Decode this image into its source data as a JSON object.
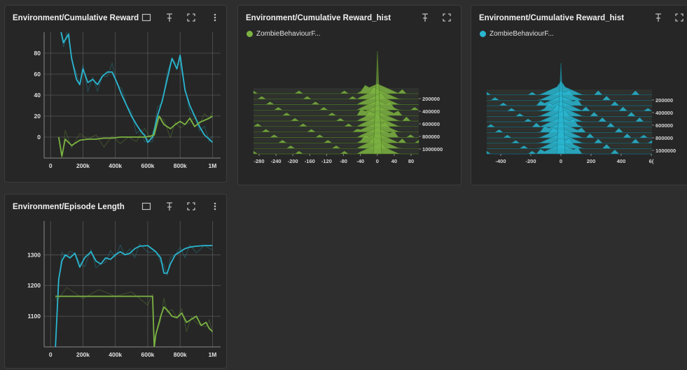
{
  "colors": {
    "cyan": "#29b6d0",
    "green": "#7cb342",
    "cyan_faint": "#2b4b52",
    "green_faint": "#3d4a2e",
    "grid": "#4a4a4a",
    "card": "#262626"
  },
  "cards": {
    "reward": {
      "title": "Environment/Cumulative Reward"
    },
    "hist_green": {
      "title": "Environment/Cumulative Reward_hist",
      "legend": "ZombieBehaviourF..."
    },
    "hist_cyan": {
      "title": "Environment/Cumulative Reward_hist",
      "legend": "ZombieBehaviourF..."
    },
    "length": {
      "title": "Environment/Episode Length"
    }
  },
  "chart_data": [
    {
      "id": "reward",
      "type": "line",
      "title": "Environment/Cumulative Reward",
      "xlim": [
        -40000,
        1050000
      ],
      "ylim": [
        -20,
        100
      ],
      "x_ticks": [
        0,
        200000,
        400000,
        600000,
        800000,
        1000000
      ],
      "x_tick_labels": [
        "0",
        "200k",
        "400k",
        "600k",
        "800k",
        "1M"
      ],
      "y_ticks": [
        0,
        20,
        40,
        60,
        80
      ],
      "y_tick_labels": [
        "0",
        "20",
        "40",
        "60",
        "80"
      ],
      "series": [
        {
          "color": "#29b6d0",
          "x": [
            50000,
            80000,
            110000,
            130000,
            160000,
            180000,
            200000,
            230000,
            260000,
            290000,
            320000,
            350000,
            380000,
            410000,
            440000,
            470000,
            500000,
            530000,
            560000,
            580000,
            600000,
            630000,
            660000,
            690000,
            720000,
            750000,
            780000,
            800000,
            830000,
            860000,
            890000,
            920000,
            950000,
            980000,
            1000000
          ],
          "y": [
            110,
            90,
            98,
            75,
            55,
            50,
            65,
            52,
            55,
            50,
            58,
            62,
            62,
            52,
            40,
            30,
            20,
            12,
            5,
            2,
            -5,
            0,
            20,
            35,
            55,
            75,
            65,
            78,
            45,
            30,
            20,
            10,
            2,
            -2,
            -5
          ]
        },
        {
          "color": "#7cb342",
          "x": [
            50000,
            70000,
            90000,
            130000,
            180000,
            230000,
            280000,
            330000,
            380000,
            430000,
            480000,
            530000,
            580000,
            620000,
            640000,
            670000,
            700000,
            740000,
            770000,
            800000,
            830000,
            860000,
            890000,
            920000,
            950000,
            980000,
            1000000
          ],
          "y": [
            0,
            -18,
            -2,
            -8,
            -3,
            -2,
            -2,
            -1,
            -1,
            0,
            0,
            0,
            0,
            1,
            2,
            20,
            12,
            8,
            12,
            15,
            12,
            18,
            10,
            14,
            16,
            18,
            20
          ]
        }
      ]
    },
    {
      "id": "hist_green",
      "type": "histogram",
      "x_tick_labels": [
        "-280",
        "-240",
        "-200",
        "-160",
        "-120",
        "-80",
        "-40",
        "0",
        "40",
        "80"
      ],
      "y_tick_labels": [
        "200000",
        "400000",
        "600000",
        "800000",
        "1000000"
      ]
    },
    {
      "id": "hist_cyan",
      "type": "histogram",
      "x_tick_labels": [
        "-400",
        "-200",
        "0",
        "200",
        "400",
        "6("
      ],
      "y_tick_labels": [
        "200000",
        "400000",
        "600000",
        "800000",
        "1000000"
      ]
    },
    {
      "id": "length",
      "type": "line",
      "title": "Environment/Episode Length",
      "xlim": [
        -40000,
        1050000
      ],
      "ylim": [
        1000,
        1410
      ],
      "x_ticks": [
        0,
        200000,
        400000,
        600000,
        800000,
        1000000
      ],
      "x_tick_labels": [
        "0",
        "200k",
        "400k",
        "600k",
        "800k",
        "1M"
      ],
      "y_ticks": [
        1100,
        1200,
        1300
      ],
      "y_tick_labels": [
        "1100",
        "1200",
        "1300"
      ],
      "series": [
        {
          "color": "#29b6d0",
          "x": [
            30000,
            50000,
            70000,
            90000,
            120000,
            150000,
            180000,
            210000,
            250000,
            280000,
            310000,
            340000,
            370000,
            400000,
            430000,
            460000,
            490000,
            520000,
            550000,
            600000,
            650000,
            680000,
            700000,
            720000,
            740000,
            770000,
            800000,
            830000,
            860000,
            900000,
            950000,
            1000000
          ],
          "y": [
            1000,
            1220,
            1280,
            1300,
            1290,
            1305,
            1260,
            1290,
            1310,
            1280,
            1270,
            1290,
            1285,
            1300,
            1310,
            1300,
            1305,
            1320,
            1328,
            1330,
            1310,
            1290,
            1240,
            1240,
            1270,
            1300,
            1310,
            1320,
            1325,
            1328,
            1330,
            1330
          ]
        },
        {
          "color": "#7cb342",
          "x": [
            30000,
            40000,
            100000,
            200000,
            300000,
            400000,
            500000,
            600000,
            630000,
            640000,
            650000,
            680000,
            700000,
            720000,
            750000,
            780000,
            810000,
            840000,
            870000,
            900000,
            930000,
            960000,
            980000,
            1000000
          ],
          "y": [
            1165,
            1165,
            1165,
            1165,
            1165,
            1165,
            1165,
            1165,
            1165,
            1000,
            1040,
            1100,
            1130,
            1120,
            1100,
            1095,
            1110,
            1080,
            1090,
            1100,
            1070,
            1080,
            1060,
            1050
          ]
        }
      ]
    }
  ]
}
